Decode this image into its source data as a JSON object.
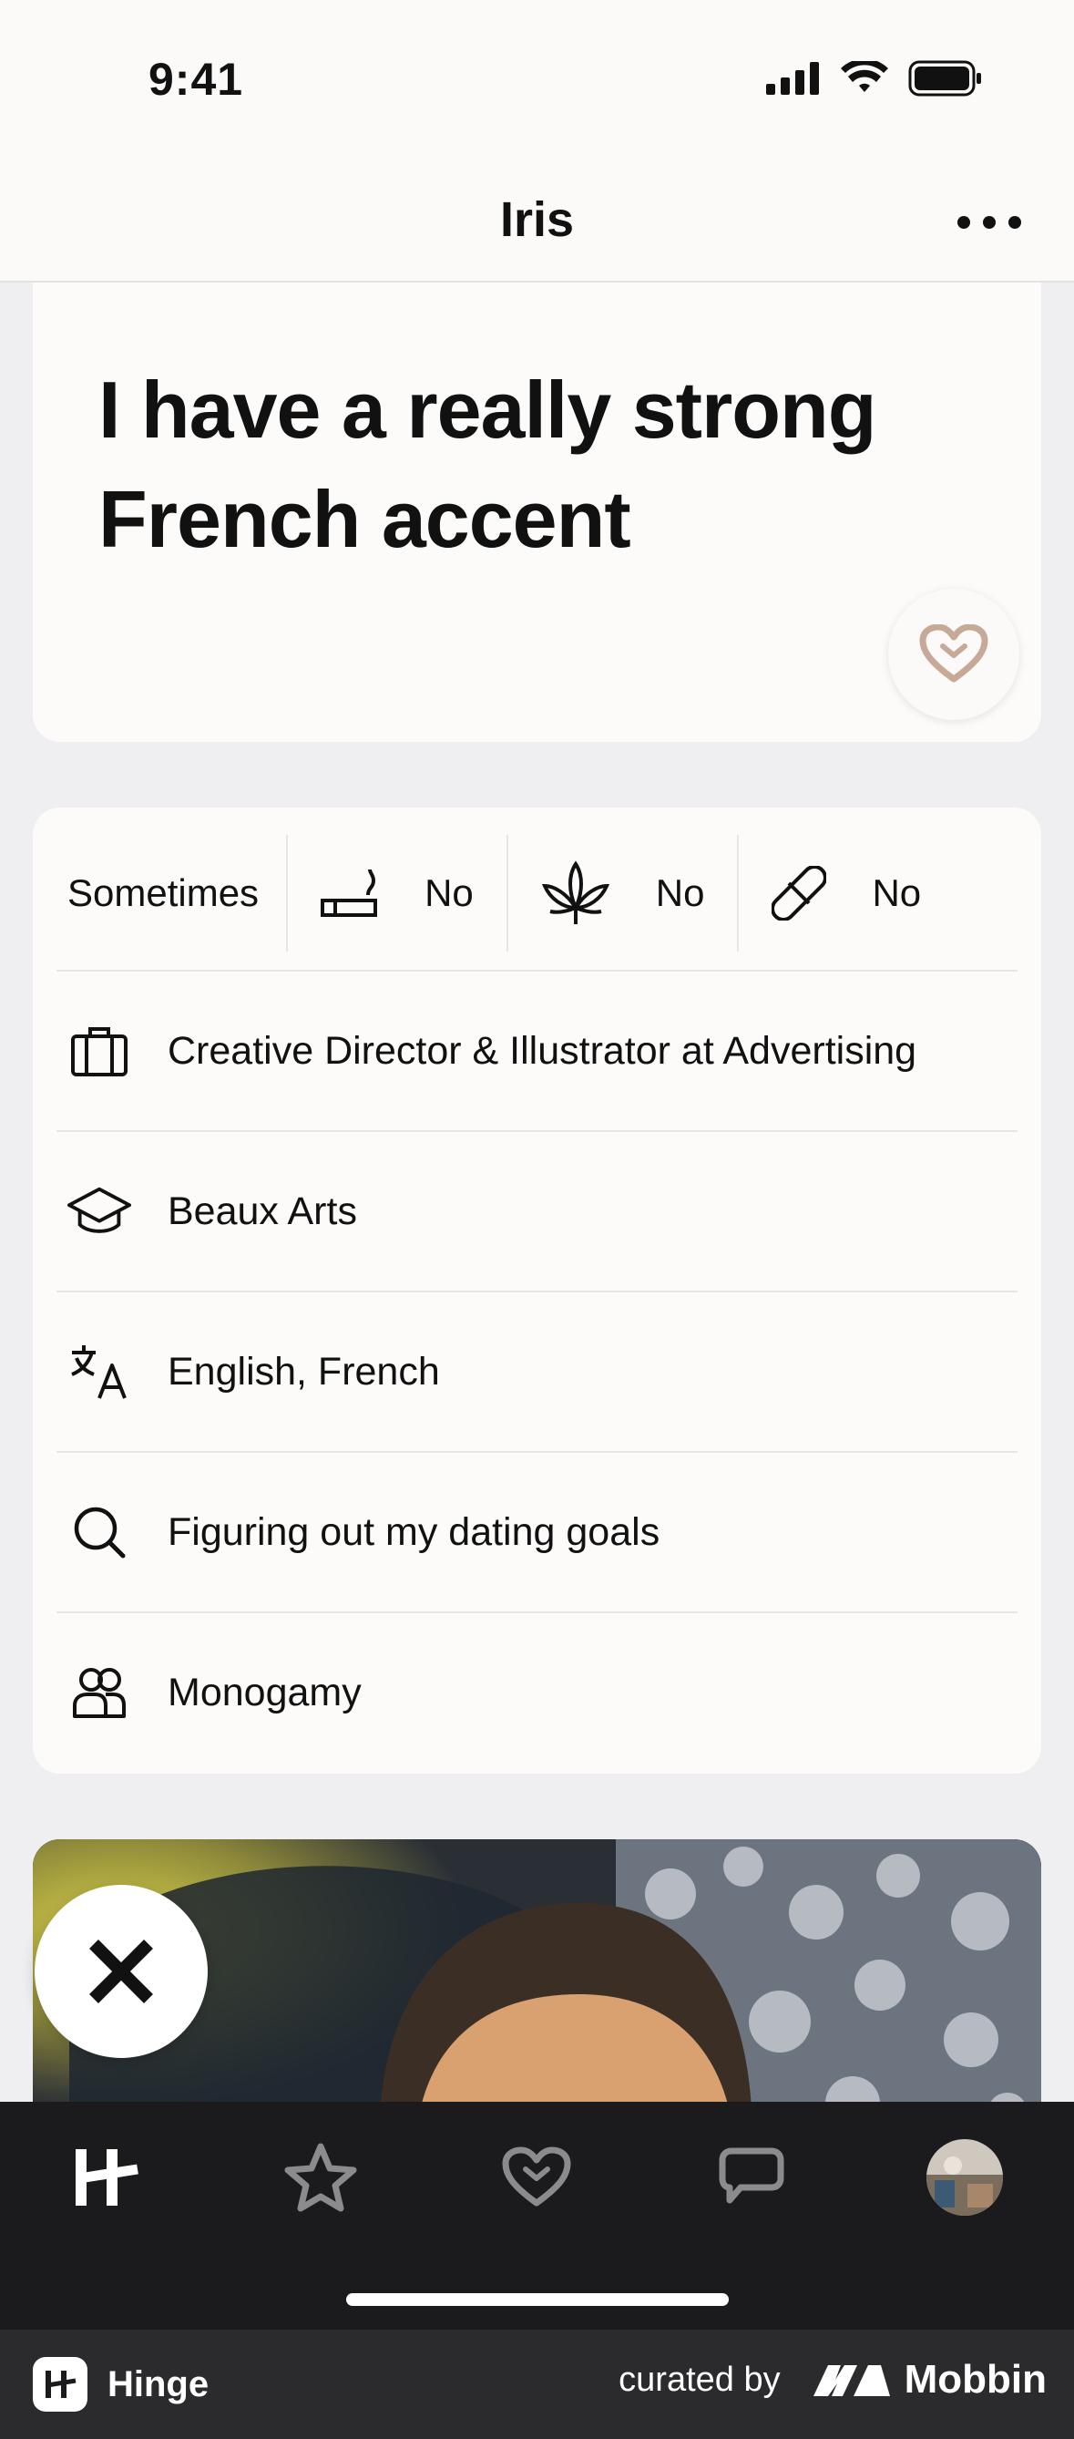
{
  "status_bar": {
    "time": "9:41"
  },
  "header": {
    "title": "Iris"
  },
  "prompt": {
    "answer": "I have a really strong French accent"
  },
  "vitals": {
    "chips": [
      {
        "icon": "drinking-icon",
        "value": "Sometimes"
      },
      {
        "icon": "smoking-icon",
        "value": "No"
      },
      {
        "icon": "marijuana-icon",
        "value": "No"
      },
      {
        "icon": "drugs-icon",
        "value": "No"
      }
    ],
    "rows": [
      {
        "icon": "briefcase-icon",
        "text": "Creative Director & Illustrator at Advertising"
      },
      {
        "icon": "graduation-cap-icon",
        "text": "Beaux Arts"
      },
      {
        "icon": "language-icon",
        "text": "English, French"
      },
      {
        "icon": "search-icon",
        "text": "Figuring out my dating goals"
      },
      {
        "icon": "people-icon",
        "text": "Monogamy"
      }
    ]
  },
  "tabs": [
    "hinge-home-icon",
    "star-icon",
    "heart-icon",
    "chat-icon",
    "profile-avatar"
  ],
  "footer": {
    "app_name": "Hinge",
    "curated_by": "curated by",
    "brand": "Mobbin"
  },
  "colors": {
    "background": "#efeff1",
    "card": "#fcfbfa",
    "like_heart": "#c7a998",
    "tabbar": "#1b1b1d"
  }
}
